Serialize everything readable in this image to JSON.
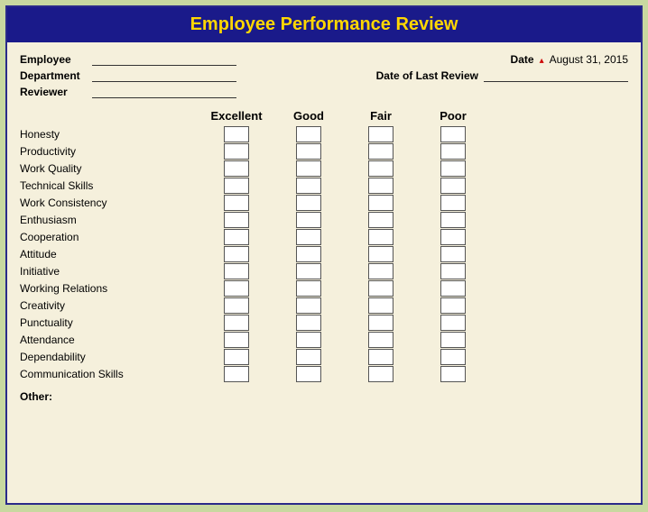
{
  "title": "Employee Performance Review",
  "header": {
    "employee_label": "Employee",
    "department_label": "Department",
    "reviewer_label": "Reviewer",
    "date_label": "Date",
    "date_value": "August 31, 2015",
    "last_review_label": "Date of Last Review"
  },
  "ratings": {
    "columns": [
      "Excellent",
      "Good",
      "Fair",
      "Poor"
    ],
    "criteria": [
      "Honesty",
      "Productivity",
      "Work Quality",
      "Technical Skills",
      "Work Consistency",
      "Enthusiasm",
      "Cooperation",
      "Attitude",
      "Initiative",
      "Working Relations",
      "Creativity",
      "Punctuality",
      "Attendance",
      "Dependability",
      "Communication Skills"
    ]
  },
  "other_label": "Other:"
}
